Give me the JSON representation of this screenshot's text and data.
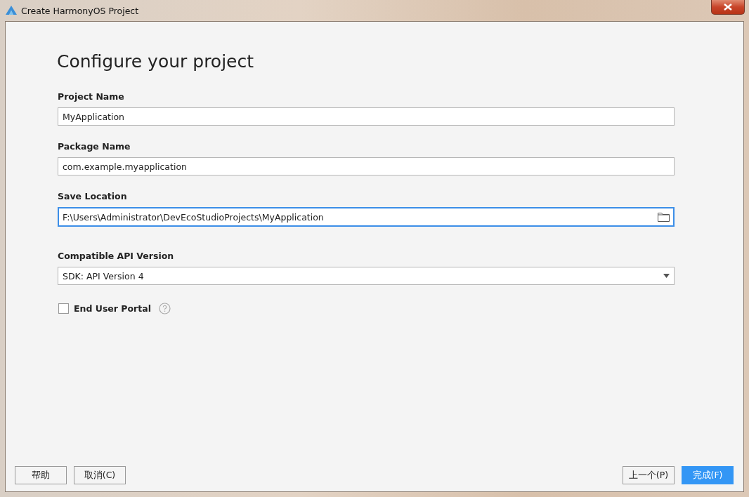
{
  "window": {
    "title": "Create HarmonyOS Project"
  },
  "heading": "Configure your project",
  "fields": [
    {
      "kind": "text",
      "label": "Project Name",
      "value": "MyApplication",
      "focused": false
    },
    {
      "kind": "text",
      "label": "Package Name",
      "value": "com.example.myapplication",
      "focused": false
    },
    {
      "kind": "browse",
      "label": "Save Location",
      "value": "F:\\Users\\Administrator\\DevEcoStudioProjects\\MyApplication",
      "focused": true
    },
    {
      "kind": "dropdown",
      "label": "Compatible API Version",
      "value": "SDK: API Version 4",
      "focused": false
    }
  ],
  "checkbox": {
    "label": "End User Portal",
    "checked": false
  },
  "left_buttons": [
    {
      "label": "帮助",
      "primary": false
    },
    {
      "label": "取消(C)",
      "primary": false
    }
  ],
  "right_buttons": [
    {
      "label": "上一个(P)",
      "primary": false
    },
    {
      "label": "完成(F)",
      "primary": true
    }
  ]
}
